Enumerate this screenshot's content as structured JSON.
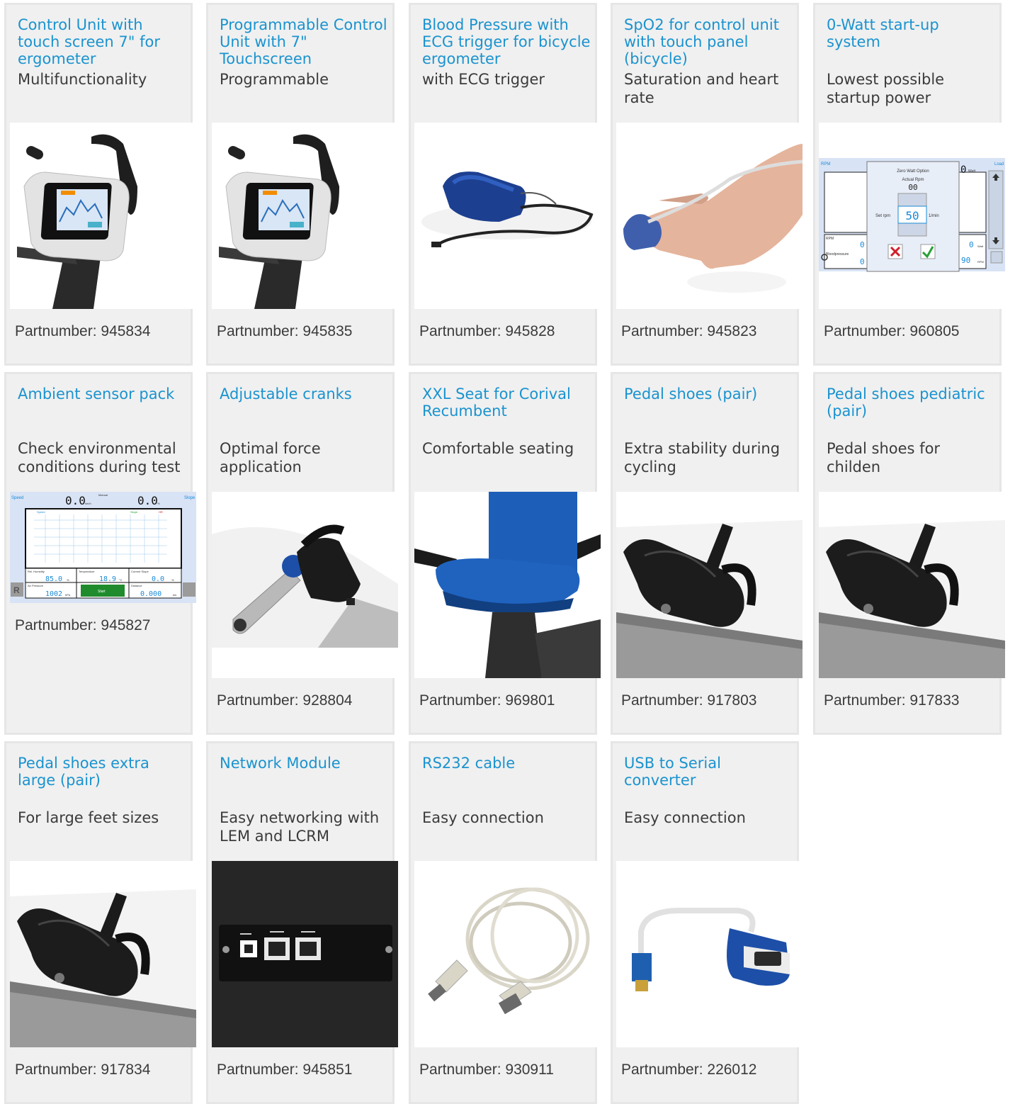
{
  "products": [
    {
      "title": "Control Unit with touch screen 7\" for ergometer",
      "subtitle": "Multifunctionality",
      "partnumber": "Partnumber: 945834",
      "image": "control-unit-touchscreen"
    },
    {
      "title": "Programmable Control Unit with 7\" Touchscreen",
      "subtitle": "Programmable",
      "partnumber": "Partnumber: 945835",
      "image": "programmable-control-unit"
    },
    {
      "title": "Blood Pressure with ECG trigger for bicycle ergometer",
      "subtitle": "with ECG trigger",
      "partnumber": "Partnumber: 945828",
      "image": "blood-pressure-cuff"
    },
    {
      "title": "SpO2 for control unit with touch panel (bicycle)",
      "subtitle": "Saturation and heart rate",
      "partnumber": "Partnumber: 945823",
      "image": "spo2-finger-sensor"
    },
    {
      "title": "0-Watt start-up system",
      "subtitle": "Lowest possible startup power",
      "partnumber": "Partnumber: 960805",
      "image": "zero-watt-screen"
    },
    {
      "title": "Ambient sensor pack",
      "subtitle": "Check environmental conditions during test",
      "partnumber": "Partnumber: 945827",
      "image": "ambient-sensor-screen"
    },
    {
      "title": "Adjustable cranks",
      "subtitle": "Optimal force application",
      "partnumber": "Partnumber: 928804",
      "image": "adjustable-crank"
    },
    {
      "title": "XXL Seat for Corival Recumbent",
      "subtitle": "Comfortable seating",
      "partnumber": "Partnumber: 969801",
      "image": "xxl-seat"
    },
    {
      "title": "Pedal shoes (pair)",
      "subtitle": "Extra stability during cycling",
      "partnumber": "Partnumber: 917803",
      "image": "pedal-shoe"
    },
    {
      "title": "Pedal shoes pediatric (pair)",
      "subtitle": "Pedal shoes for childen",
      "partnumber": "Partnumber: 917833",
      "image": "pedal-shoe"
    },
    {
      "title": "Pedal shoes extra large (pair)",
      "subtitle": "For large feet sizes",
      "partnumber": "Partnumber: 917834",
      "image": "pedal-shoe"
    },
    {
      "title": "Network Module",
      "subtitle": "Easy networking with LEM and LCRM",
      "partnumber": "Partnumber: 945851",
      "image": "network-module"
    },
    {
      "title": "RS232 cable",
      "subtitle": "Easy connection",
      "partnumber": "Partnumber: 930911",
      "image": "rs232-cable"
    },
    {
      "title": "USB to Serial converter",
      "subtitle": "Easy connection",
      "partnumber": "Partnumber: 226012",
      "image": "usb-serial-converter"
    }
  ],
  "screens": {
    "zero_watt": {
      "rpm_label": "RPM",
      "load_label": "Load",
      "dialog_title": "Zero Watt Option",
      "actual_rpm_label": "Actual Rpm",
      "actual_rpm_value": "00",
      "set_rpm_label": "Set rpm",
      "set_rpm_value": "50",
      "unit_label": "1/min",
      "watt_unit": "Watt",
      "rpm_unit": "RPM",
      "rpm_small": "RPM",
      "bp_label": "Bloodpressure",
      "readout_watt": "0",
      "readout_rpm": "90",
      "readout_top": "0",
      "readout_left_1": "0",
      "readout_left_2": "0"
    },
    "ambient": {
      "speed_label": "Speed",
      "manual_label": "Manual",
      "slope_label": "Slope",
      "speed_value": "0.0",
      "speed_unit": "km/h",
      "slope_value": "0.0",
      "slope_unit": "%",
      "legend_speed": "Speed",
      "legend_slope": "Slope",
      "legend_hr": "HR",
      "humidity_label": "Rel. Humidity",
      "humidity_value": "85.0",
      "humidity_unit": "%",
      "temperature_label": "Temperature",
      "temperature_value": "18.9",
      "temperature_unit": "°C",
      "current_slope_label": "Current Slope",
      "current_slope_value": "0.0",
      "current_slope_unit": "%",
      "air_pressure_label": "Air Pressure",
      "air_pressure_value": "1002",
      "air_pressure_unit": "hPa",
      "start_label": "Start",
      "distance_label": "Distance",
      "distance_value": "0.000",
      "distance_unit": "km",
      "r_key": "R"
    }
  },
  "colors": {
    "title": "#1a93cf",
    "text": "#3b3b3b",
    "card_bg": "#f0f0f0",
    "card_border": "#e6e6e6"
  }
}
